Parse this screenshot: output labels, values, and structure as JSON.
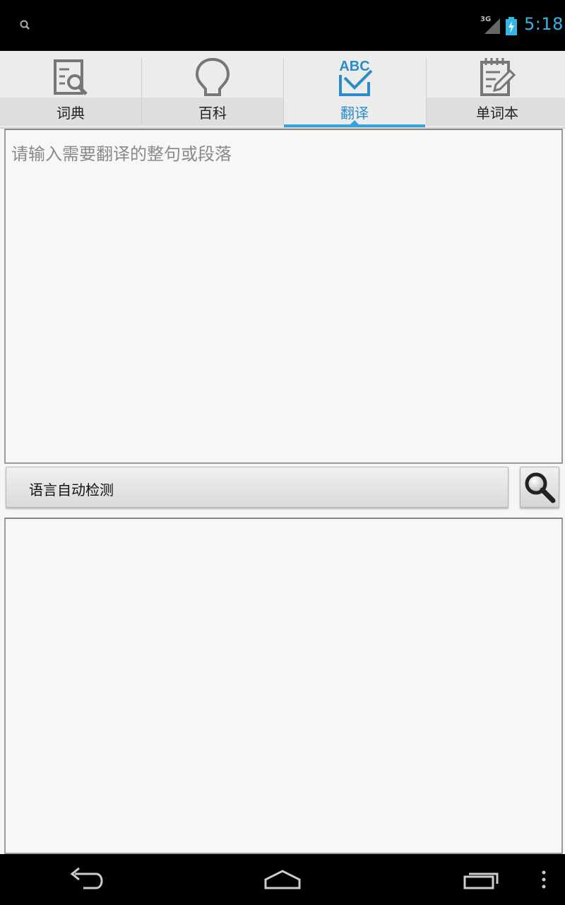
{
  "status_bar": {
    "network_label": "3G",
    "time": "5:18",
    "icons": [
      "search-icon",
      "signal-icon",
      "battery-charging-icon"
    ],
    "accent_color": "#33b5e5"
  },
  "tabs": [
    {
      "label": "词典",
      "icon": "dictionary-search-icon",
      "active": false
    },
    {
      "label": "百科",
      "icon": "lightbulb-icon",
      "active": false
    },
    {
      "label": "翻译",
      "icon": "abc-check-icon",
      "icon_text": "ABC",
      "active": true
    },
    {
      "label": "单词本",
      "icon": "notepad-pencil-icon",
      "active": false
    }
  ],
  "translate": {
    "input_placeholder": "请输入需要翻译的整句或段落",
    "language_selector": "语言自动检测",
    "output_text": ""
  },
  "nav_bar": {
    "buttons": [
      "back-icon",
      "home-icon",
      "recent-apps-icon",
      "overflow-menu-icon"
    ]
  }
}
